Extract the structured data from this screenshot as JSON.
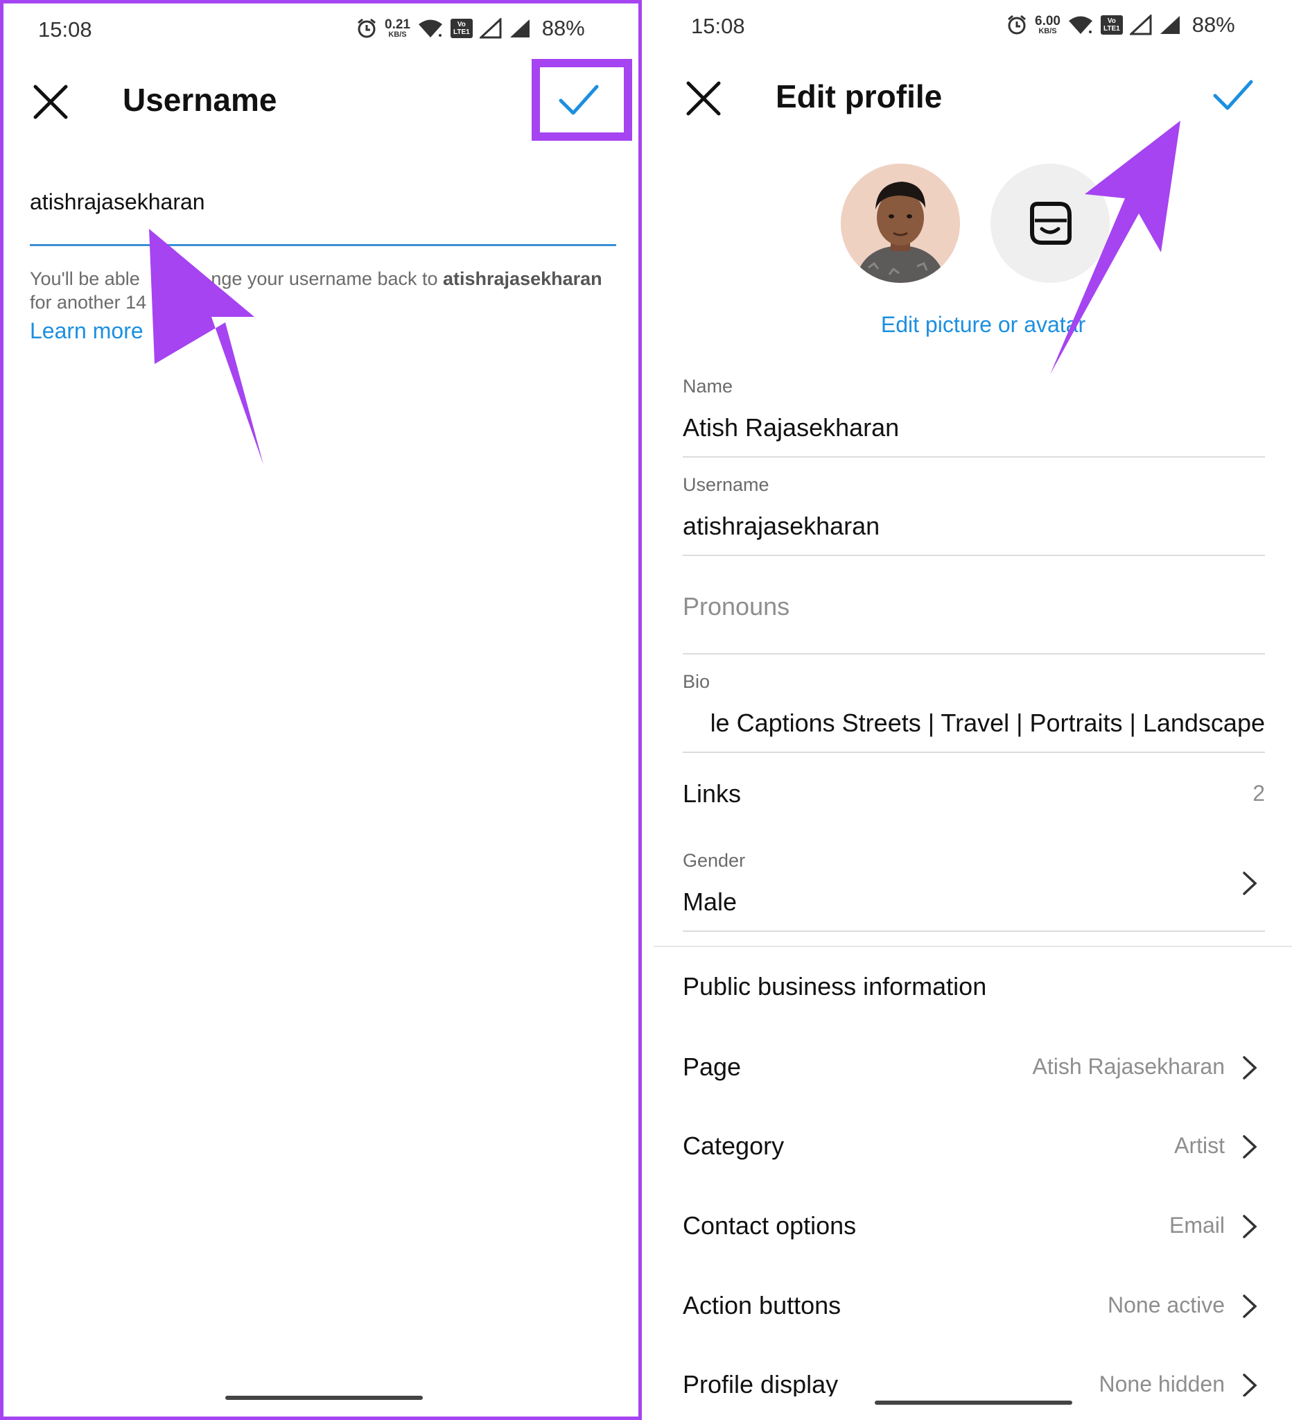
{
  "colors": {
    "accent": "#a544f0",
    "link": "#1c8fe0",
    "check": "#1c8fe0",
    "input_underline": "#3a8fd6"
  },
  "left": {
    "status": {
      "time": "15:08",
      "net_speed": "0.21",
      "net_unit": "KB/S",
      "volte": "Vo LTE 1",
      "battery": "88%"
    },
    "header": {
      "title": "Username",
      "close_icon": "close-icon",
      "confirm_icon": "check-icon"
    },
    "username_value": "atishrajasekharan",
    "helper": {
      "part1": "You'll be able ",
      "part2": "nge your username back to ",
      "bold_name": "atishrajasekharan",
      "line2": "for another 14"
    },
    "learn_more": "Learn more"
  },
  "right": {
    "status": {
      "time": "15:08",
      "net_speed": "6.00",
      "net_unit": "KB/S",
      "volte": "Vo LTE 1",
      "battery": "88%"
    },
    "header": {
      "title": "Edit profile",
      "close_icon": "close-icon",
      "confirm_icon": "check-icon"
    },
    "avatar_icon": "avatar-sticker-icon",
    "edit_picture": "Edit picture or avatar",
    "fields": {
      "name": {
        "label": "Name",
        "value": "Atish Rajasekharan"
      },
      "username": {
        "label": "Username",
        "value": "atishrajasekharan"
      },
      "pronouns": {
        "placeholder": "Pronouns"
      },
      "bio": {
        "label": "Bio",
        "value": "le Captions Streets | Travel | Portraits | Landscape"
      },
      "links": {
        "label": "Links",
        "count": "2"
      },
      "gender": {
        "label": "Gender",
        "value": "Male"
      }
    },
    "business": {
      "heading": "Public business information",
      "rows": [
        {
          "label": "Page",
          "value": "Atish Rajasekharan"
        },
        {
          "label": "Category",
          "value": "Artist"
        },
        {
          "label": "Contact options",
          "value": "Email"
        },
        {
          "label": "Action buttons",
          "value": "None active"
        },
        {
          "label": "Profile display",
          "value": "None hidden"
        }
      ]
    }
  }
}
